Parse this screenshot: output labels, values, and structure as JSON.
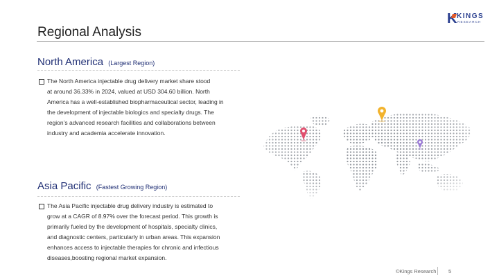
{
  "logo": {
    "text": "KINGS",
    "subtext": "RESEARCH"
  },
  "page": {
    "title": "Regional Analysis"
  },
  "north_america": {
    "heading": "North America",
    "subheading": "(Largest Region)",
    "lines": [
      "The North America injectable drug delivery market share stood",
      "at around 36.33% in 2024, valued at USD 304.60 billion. North",
      "America has a well-established biopharmaceutical sector, leading in",
      "the development of injectable biologics and specialty drugs. The",
      "region’s advanced research facilities and collaborations between",
      "industry and academia accelerate innovation."
    ]
  },
  "asia_pacific": {
    "heading": "Asia Pacific",
    "subheading": "(Fastest Growing Region)",
    "lines": [
      "The Asia Pacific injectable drug delivery industry is estimated to",
      "grow at a CAGR of 8.97% over the forecast period. This growth is",
      "primarily fueled by the development of hospitals, specialty clinics,",
      "and diagnostic centers, particularly in urban areas. This expansion",
      "enhances access to injectable therapies for chronic and infectious",
      "diseases,boosting regional market expansion."
    ]
  },
  "map": {
    "markers": [
      {
        "name": "north-america-pin",
        "color": "#e0506f"
      },
      {
        "name": "asia-pin",
        "color": "#f2b32e"
      },
      {
        "name": "asia-pacific-pin",
        "color": "#9a7ad6"
      }
    ]
  },
  "footer": {
    "copyright": "©Kings Research",
    "page_number": "5"
  }
}
